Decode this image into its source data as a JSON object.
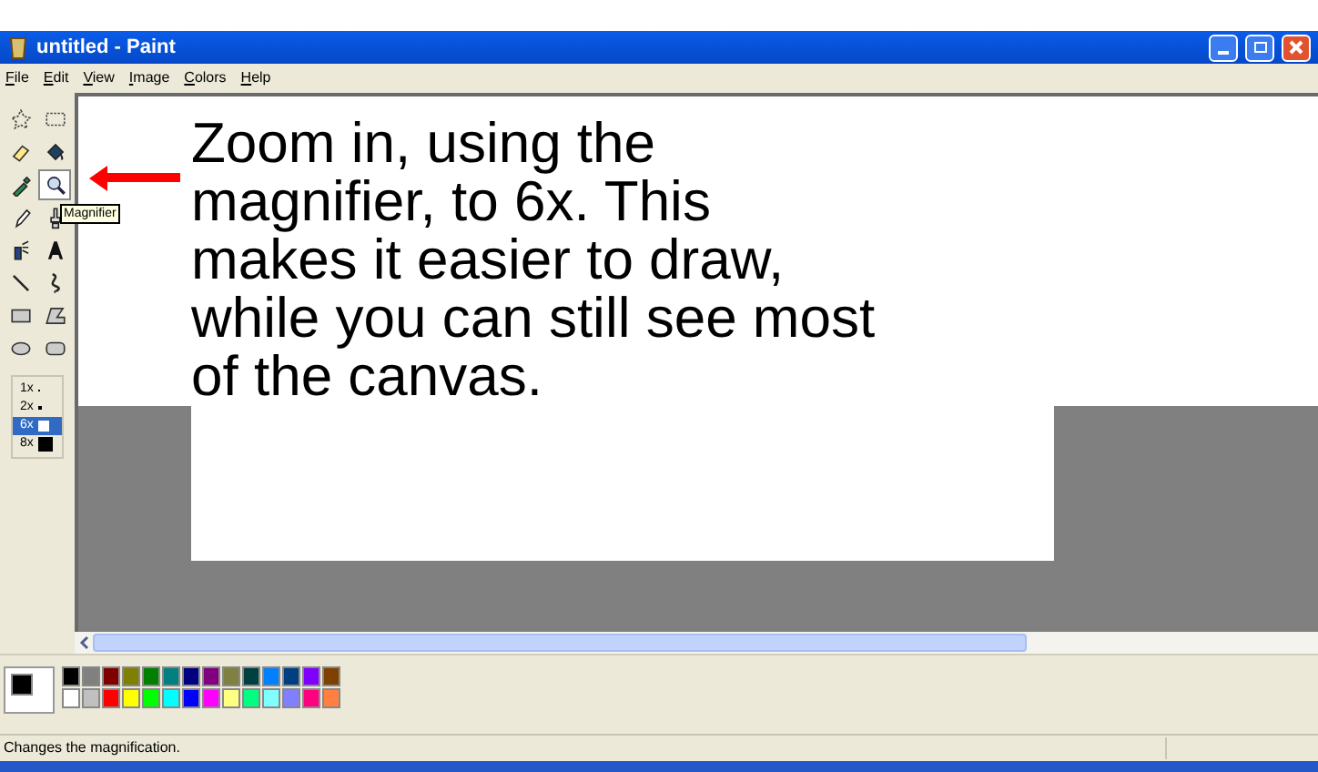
{
  "window": {
    "title": "untitled - Paint"
  },
  "menu": [
    "File",
    "Edit",
    "View",
    "Image",
    "Colors",
    "Help"
  ],
  "tools": [
    {
      "selected": false
    },
    {
      "selected": false
    },
    {
      "selected": false
    },
    {
      "selected": false
    },
    {
      "selected": false
    },
    {
      "selected": true
    },
    {
      "selected": false
    },
    {
      "selected": false
    },
    {
      "selected": false
    },
    {
      "selected": false
    },
    {
      "selected": false
    },
    {
      "selected": false
    },
    {
      "selected": false
    },
    {
      "selected": false
    },
    {
      "selected": false
    },
    {
      "selected": false
    }
  ],
  "tooltip": "Magnifier",
  "zoom_options": [
    {
      "label": "1x",
      "selected": false
    },
    {
      "label": "2x",
      "selected": false
    },
    {
      "label": "6x",
      "selected": true
    },
    {
      "label": "8x",
      "selected": false
    }
  ],
  "canvas_text": [
    "Zoom in, using the",
    "magnifier, to 6x. This",
    "makes it easier to draw,",
    "while you can still see most",
    "of the canvas."
  ],
  "palette": [
    {
      "color": "#000000"
    },
    {
      "color": "#808080"
    },
    {
      "color": "#800000"
    },
    {
      "color": "#808000"
    },
    {
      "color": "#008000"
    },
    {
      "color": "#008080"
    },
    {
      "color": "#000080"
    },
    {
      "color": "#800080"
    },
    {
      "color": "#808040"
    },
    {
      "color": "#004040"
    },
    {
      "color": "#0080ff"
    },
    {
      "color": "#004080"
    },
    {
      "color": "#8000ff"
    },
    {
      "color": "#804000"
    },
    {
      "color": "#ffffff"
    },
    {
      "color": "#c0c0c0"
    },
    {
      "color": "#ff0000"
    },
    {
      "color": "#ffff00"
    },
    {
      "color": "#00ff00"
    },
    {
      "color": "#00ffff"
    },
    {
      "color": "#0000ff"
    },
    {
      "color": "#ff00ff"
    },
    {
      "color": "#ffff80"
    },
    {
      "color": "#00ff80"
    },
    {
      "color": "#80ffff"
    },
    {
      "color": "#8080ff"
    },
    {
      "color": "#ff0080"
    },
    {
      "color": "#ff8040"
    }
  ],
  "status_bar": "Changes the magnification."
}
